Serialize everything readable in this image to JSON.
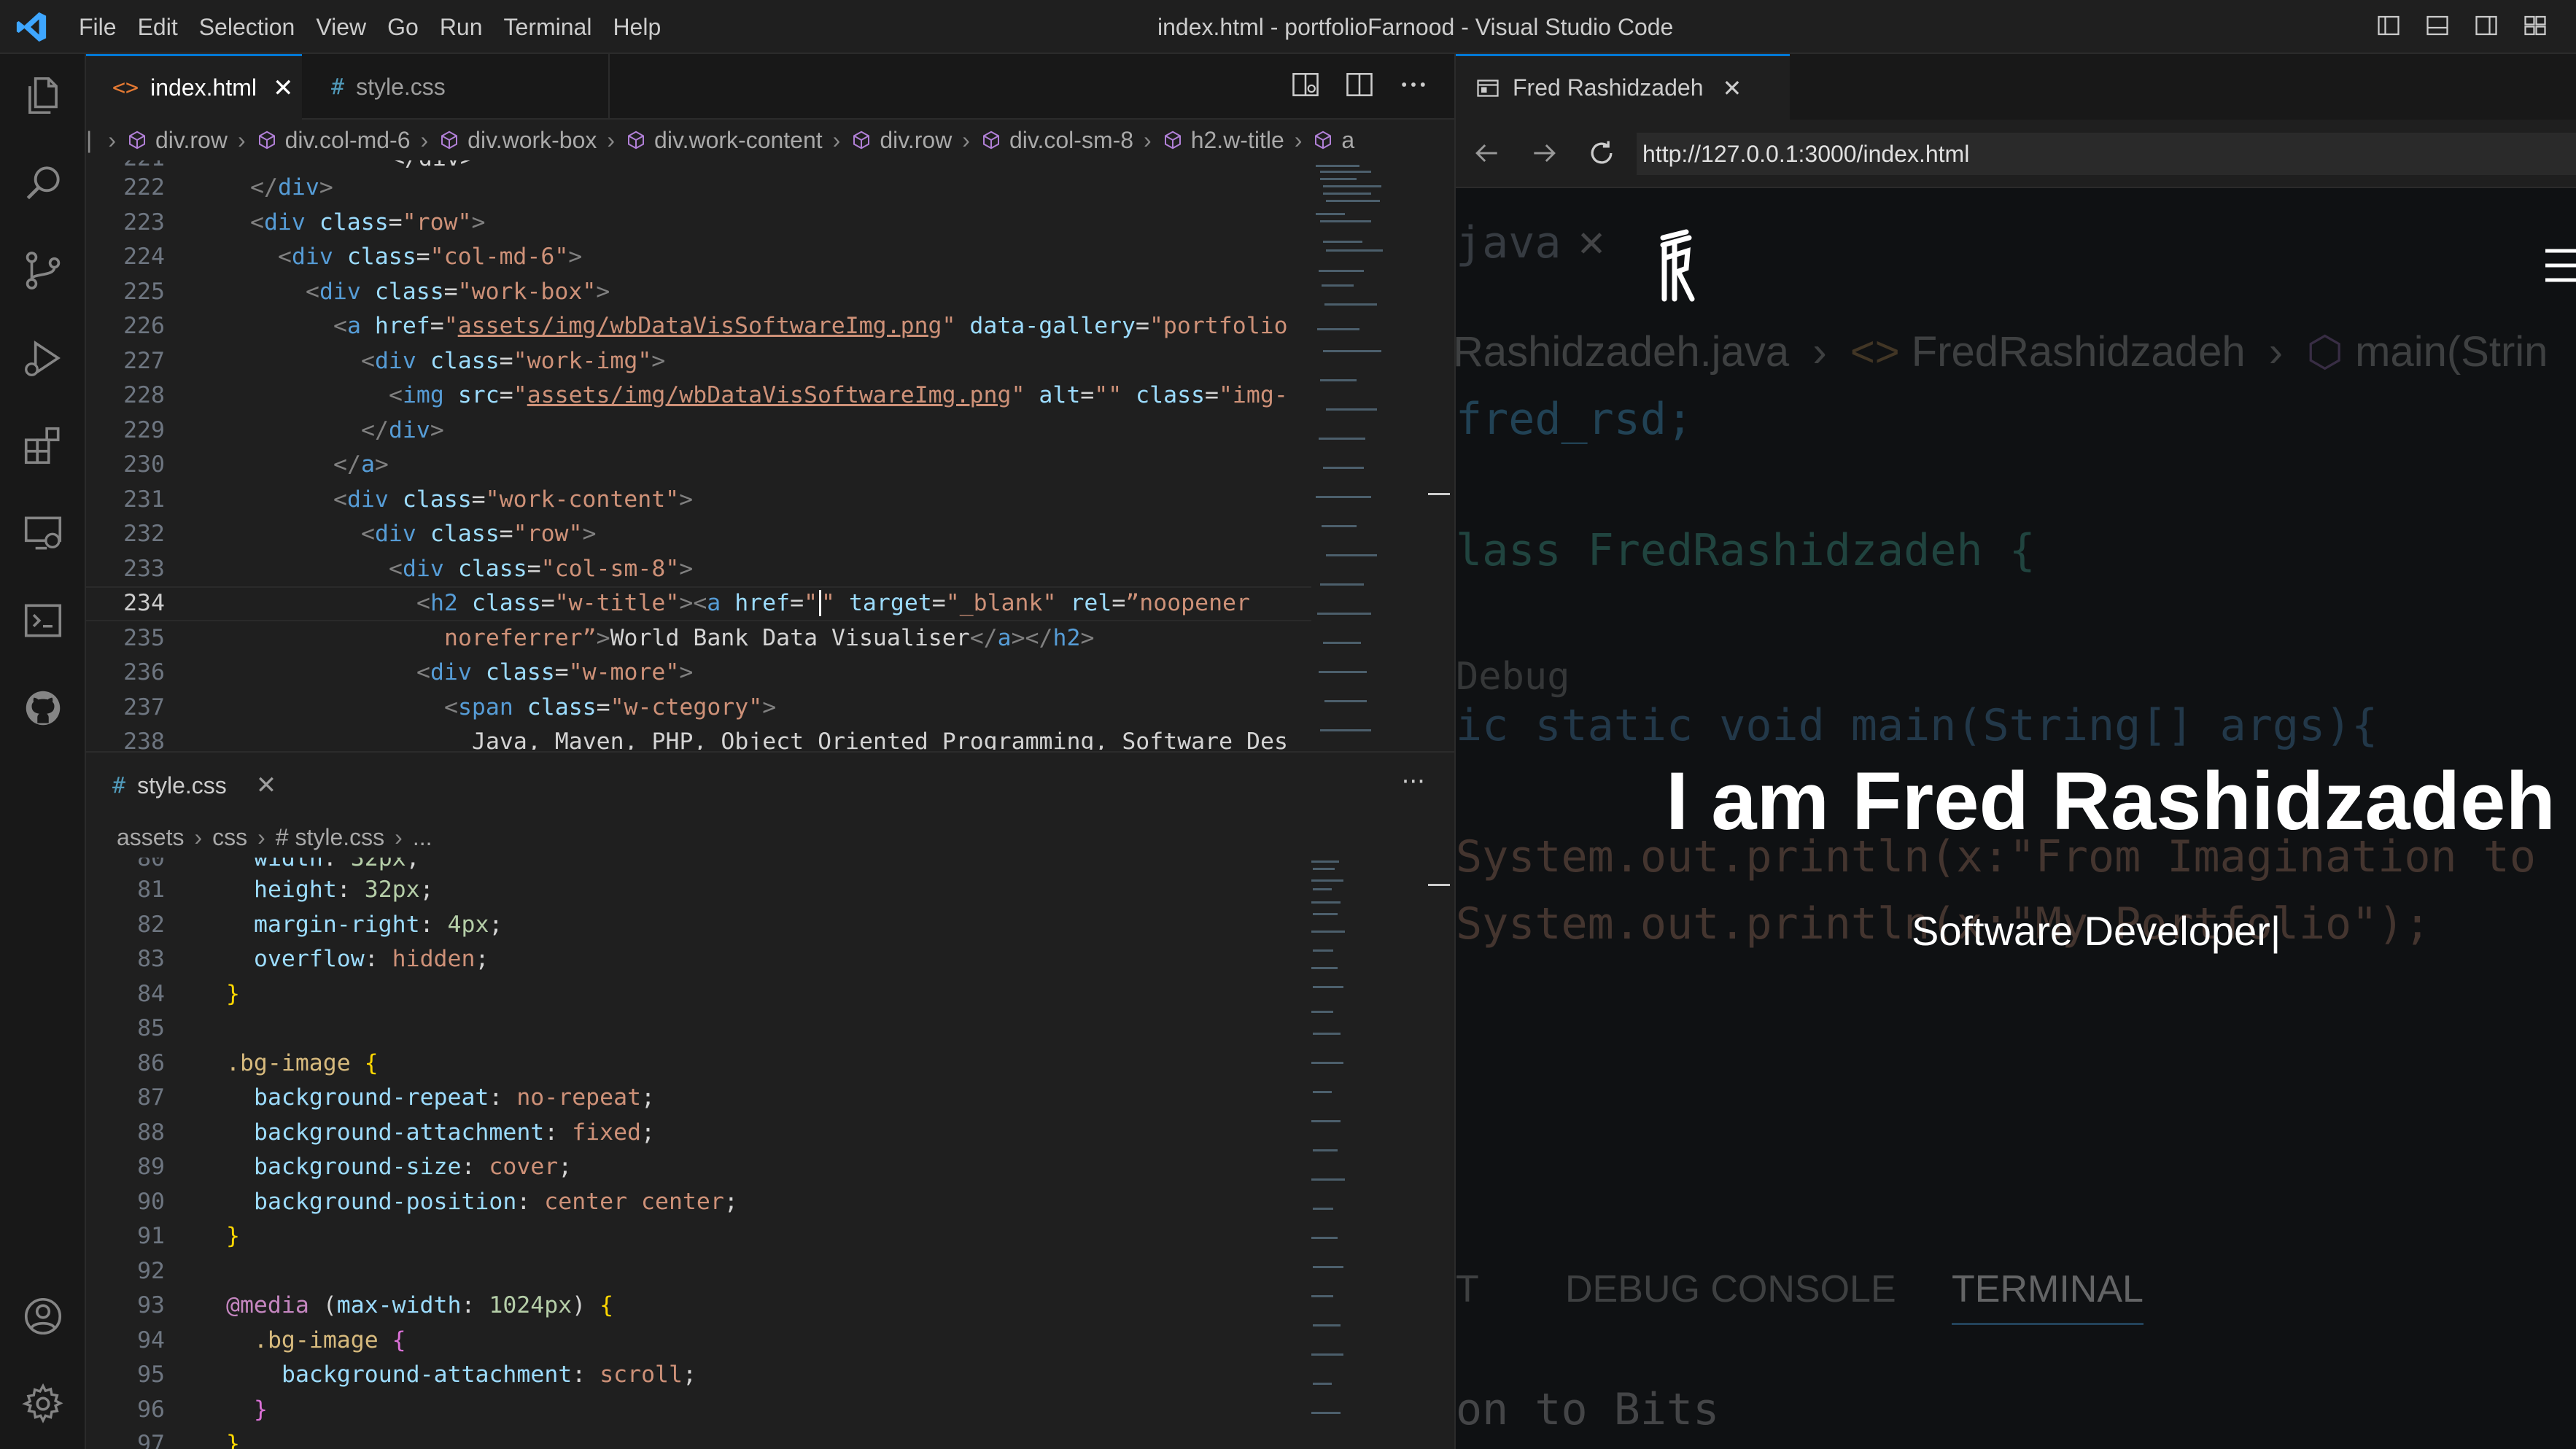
{
  "window": {
    "title": "index.html - portfolioFarnood - Visual Studio Code",
    "menu": [
      "File",
      "Edit",
      "Selection",
      "View",
      "Go",
      "Run",
      "Terminal",
      "Help"
    ]
  },
  "activity_icons": [
    "explorer-icon",
    "search-icon",
    "source-control-icon",
    "run-debug-icon",
    "extensions-icon",
    "remote-explorer-icon",
    "terminal-icon",
    "github-icon",
    "account-icon",
    "settings-gear-icon"
  ],
  "editor1": {
    "tabs": [
      {
        "icon": "<>",
        "label": "index.html",
        "close": "✕"
      },
      {
        "icon": "#",
        "label": "style.css"
      }
    ],
    "breadcrumbs": [
      "div.row",
      "div.col-md-6",
      "div.work-box",
      "div.work-content",
      "div.row",
      "div.col-sm-8",
      "h2.w-title",
      "a"
    ],
    "partial_line_top": "221",
    "lines": [
      {
        "n": "222",
        "code": "</div>"
      },
      {
        "n": "223",
        "code": "<div class=\"row\">"
      },
      {
        "n": "224",
        "code": "<div class=\"col-md-6\">"
      },
      {
        "n": "225",
        "code": "<div class=\"work-box\">"
      },
      {
        "n": "226",
        "code": "<a href=\"assets/img/wbDataVisSoftwareImg.png\" data-gallery=\"portfolio"
      },
      {
        "n": "227",
        "code": "<div class=\"work-img\">"
      },
      {
        "n": "228",
        "code": "<img src=\"assets/img/wbDataVisSoftwareImg.png\" alt=\"\" class=\"img-"
      },
      {
        "n": "229",
        "code": "</div>"
      },
      {
        "n": "230",
        "code": "</a>"
      },
      {
        "n": "231",
        "code": "<div class=\"work-content\">"
      },
      {
        "n": "232",
        "code": "<div class=\"row\">"
      },
      {
        "n": "233",
        "code": "<div class=\"col-sm-8\">"
      },
      {
        "n": "234",
        "code": "<h2 class=\"w-title\"><a href=\"\" target=\"_blank\" rel=”noopener"
      },
      {
        "n": "235",
        "code": "noreferrer”>World Bank Data Visualiser</a></h2>"
      },
      {
        "n": "236",
        "code": "<div class=\"w-more\">"
      },
      {
        "n": "237",
        "code": "<span class=\"w-ctegory\">"
      },
      {
        "n": "238",
        "code": "Java, Maven, PHP, Object Oriented Programming, Software Des"
      }
    ]
  },
  "editor2": {
    "tab": {
      "icon": "#",
      "label": "style.css",
      "close": "✕"
    },
    "more": "···",
    "breadcrumbs": [
      "assets",
      "css",
      "# style.css",
      "..."
    ],
    "partial_line_top": {
      "n": "80",
      "code": "width: 32px;"
    },
    "lines": [
      {
        "n": "81",
        "code": "height: 32px;"
      },
      {
        "n": "82",
        "code": "margin-right: 4px;"
      },
      {
        "n": "83",
        "code": "overflow: hidden;"
      },
      {
        "n": "84",
        "code": "}"
      },
      {
        "n": "85",
        "code": ""
      },
      {
        "n": "86",
        "code": ".bg-image {"
      },
      {
        "n": "87",
        "code": "background-repeat: no-repeat;"
      },
      {
        "n": "88",
        "code": "background-attachment: fixed;"
      },
      {
        "n": "89",
        "code": "background-size: cover;"
      },
      {
        "n": "90",
        "code": "background-position: center center;"
      },
      {
        "n": "91",
        "code": "}"
      },
      {
        "n": "92",
        "code": ""
      },
      {
        "n": "93",
        "code": "@media (max-width: 1024px) {"
      },
      {
        "n": "94",
        "code": ".bg-image {"
      },
      {
        "n": "95",
        "code": "background-attachment: scroll;"
      },
      {
        "n": "96",
        "code": "}"
      },
      {
        "n": "97",
        "code": "}"
      }
    ]
  },
  "browser": {
    "tab_label": "Fred Rashidzadeh",
    "tab_close": "✕",
    "url": "http://127.0.0.1:3000/index.html",
    "hero_title": "I am Fred Rashidzadeh",
    "hero_subtitle": "Software Developer|",
    "bg": {
      "tab_fragment": "java",
      "tab_close": "✕",
      "crumb1": "Rashidzadeh.java",
      "crumb2": "FredRashidzadeh",
      "crumb3": "main(Strin",
      "code1": "fred_rsd;",
      "code2": "lass FredRashidzadeh {",
      "code3": "Debug",
      "code4": "ic static void main(String[] args){",
      "code5": "System.out.println(x:\"From Imagination to",
      "code6": "System.out.println(x:\"My Portfolio\");",
      "panel1": "T",
      "panel2": "DEBUG CONSOLE",
      "panel3": "TERMINAL",
      "term": "on to Bits"
    }
  },
  "colors": {
    "accent": "#0078d4",
    "tag": "#569cd6",
    "attr": "#9cdcfe",
    "string": "#ce9178",
    "selector": "#d7ba7d",
    "keyword": "#c586c0"
  }
}
